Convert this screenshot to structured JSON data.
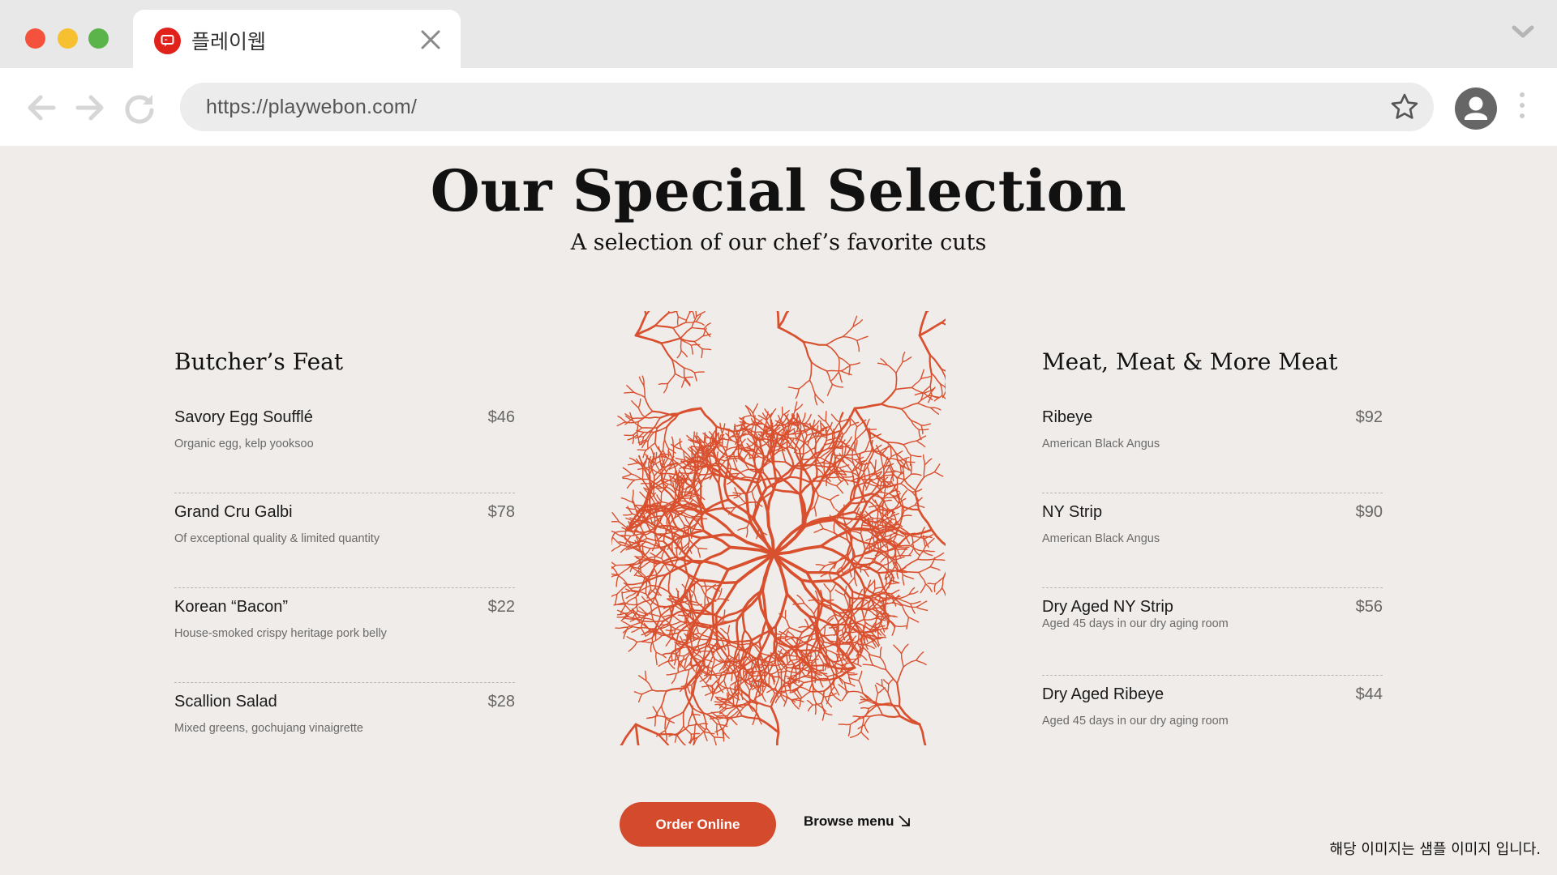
{
  "browser": {
    "tab_title": "플레이웹",
    "url": "https://playwebon.com/"
  },
  "colors": {
    "accent": "#d34a2d",
    "page_background": "#f0ece9",
    "pattern": "#d9502f"
  },
  "header": {
    "title": "Our Special Selection",
    "subtitle": "A selection of our chef’s favorite cuts"
  },
  "menu_left": {
    "title": "Butcher’s Feat",
    "items": [
      {
        "name": "Savory Egg Soufflé",
        "price": "$46",
        "desc": "Organic egg, kelp yooksoo"
      },
      {
        "name": "Grand Cru Galbi",
        "price": "$78",
        "desc": "Of exceptional quality & limited quantity"
      },
      {
        "name": "Korean “Bacon”",
        "price": "$22",
        "desc": "House-smoked crispy heritage pork belly"
      },
      {
        "name": "Scallion Salad",
        "price": "$28",
        "desc": "Mixed greens, gochujang vinaigrette"
      }
    ]
  },
  "menu_right": {
    "title": "Meat, Meat & More Meat",
    "items": [
      {
        "name": "Ribeye",
        "price": "$92",
        "desc": "American Black Angus"
      },
      {
        "name": "NY Strip",
        "price": "$90",
        "desc": "American Black Angus"
      },
      {
        "name": "Dry Aged NY Strip",
        "price": "$56",
        "desc": "Aged 45 days in our dry aging room"
      },
      {
        "name": "Dry Aged Ribeye",
        "price": "$44",
        "desc": "Aged 45 days in our dry aging room"
      }
    ]
  },
  "actions": {
    "order_label": "Order Online",
    "browse_label": "Browse menu"
  },
  "notice": "해당 이미지는 샘플 이미지 입니다.",
  "icons": [
    "favicon-icon",
    "close-icon",
    "chevron-down-icon",
    "back-arrow-icon",
    "forward-arrow-icon",
    "reload-icon",
    "star-icon",
    "profile-icon",
    "kebab-menu-icon",
    "arrow-down-right-icon"
  ]
}
